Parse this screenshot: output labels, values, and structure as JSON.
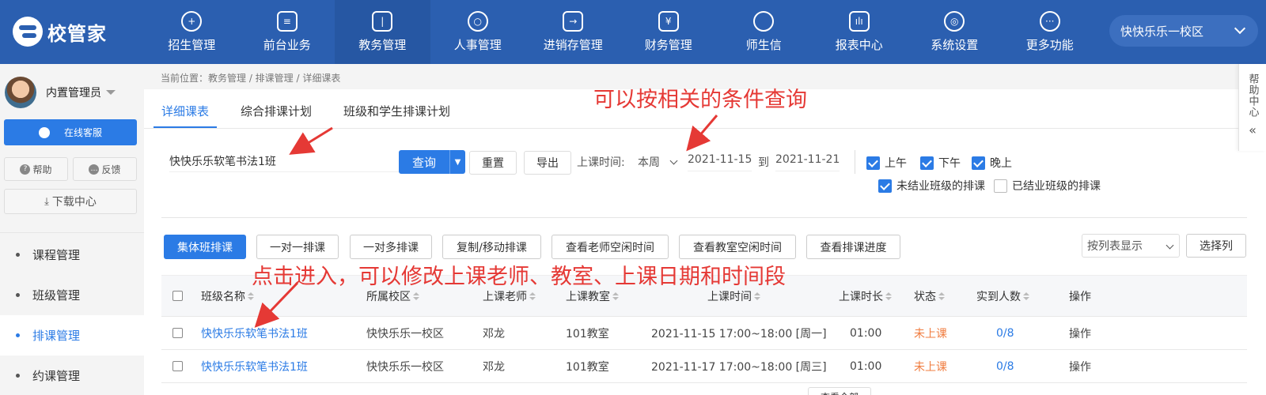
{
  "app": {
    "logo_text": "校管家",
    "campus_selector": "快快乐乐一校区"
  },
  "top_nav": [
    {
      "label": "招生管理",
      "icon": "person-add-icon",
      "active": false
    },
    {
      "label": "前台业务",
      "icon": "monitor-icon",
      "active": false
    },
    {
      "label": "教务管理",
      "icon": "book-icon",
      "active": true
    },
    {
      "label": "人事管理",
      "icon": "person-icon",
      "active": false
    },
    {
      "label": "进销存管理",
      "icon": "inventory-icon",
      "active": false
    },
    {
      "label": "财务管理",
      "icon": "yuan-icon",
      "active": false
    },
    {
      "label": "师生信",
      "icon": "chat-icon",
      "active": false
    },
    {
      "label": "报表中心",
      "icon": "report-icon",
      "active": false
    },
    {
      "label": "系统设置",
      "icon": "settings-icon",
      "active": false
    },
    {
      "label": "更多功能",
      "icon": "more-icon",
      "active": false
    }
  ],
  "sidebar": {
    "user_name": "内置管理员",
    "online_service": "在线客服",
    "help": "帮助",
    "feedback": "反馈",
    "download_center": "下载中心",
    "menu": [
      {
        "label": "课程管理",
        "active": false
      },
      {
        "label": "班级管理",
        "active": false
      },
      {
        "label": "排课管理",
        "active": true
      },
      {
        "label": "约课管理",
        "active": false
      }
    ]
  },
  "breadcrumb": "当前位置：教务管理 / 排课管理 / 详细课表",
  "tabs": [
    {
      "label": "详细课表",
      "active": true
    },
    {
      "label": "综合排课计划",
      "active": false
    },
    {
      "label": "班级和学生排课计划",
      "active": false
    }
  ],
  "filters": {
    "search_value": "快快乐乐软笔书法1班",
    "query_label": "查询",
    "reset_label": "重置",
    "export_label": "导出",
    "time_label": "上课时间:",
    "week_value": "本周",
    "date_from": "2021-11-15",
    "to_label": "到",
    "date_to": "2021-11-21",
    "morning": "上午",
    "afternoon": "下午",
    "evening": "晚上",
    "unfinished_class": "未结业班级的排课",
    "finished_class": "已结业班级的排课"
  },
  "actions": {
    "group_schedule": "集体班排课",
    "one_to_one": "一对一排课",
    "one_to_many": "一对多排课",
    "copy_move": "复制/移动排课",
    "teacher_free": "查看老师空闲时间",
    "room_free": "查看教室空闲时间",
    "progress": "查看排课进度",
    "view_mode": "按列表显示",
    "choose_columns": "选择列"
  },
  "table": {
    "headers": [
      "班级名称",
      "所属校区",
      "上课老师",
      "上课教室",
      "上课时间",
      "上课时长",
      "状态",
      "实到人数",
      "操作"
    ],
    "rows": [
      {
        "class_name": "快快乐乐软笔书法1班",
        "campus": "快快乐乐一校区",
        "teacher": "邓龙",
        "room": "101教室",
        "time": "2021-11-15 17:00~18:00 [周一]",
        "duration": "01:00",
        "status": "未上课",
        "attendance": "0/8",
        "op": "操作"
      },
      {
        "class_name": "快快乐乐软笔书法1班",
        "campus": "快快乐乐一校区",
        "teacher": "邓龙",
        "room": "101教室",
        "time": "2021-11-17 17:00~18:00 [周三]",
        "duration": "01:00",
        "status": "未上课",
        "attendance": "0/8",
        "op": "操作"
      }
    ],
    "partial_button": "查看全部"
  },
  "help_panel": {
    "label": "帮助中心"
  },
  "annotations": {
    "query_note": "可以按相关的条件查询",
    "edit_note": "点击进入，可以修改上课老师、教室、上课日期和时间段"
  },
  "colors": {
    "nav_bg": "#2b5fb0",
    "primary": "#2b7be5",
    "status_not_started": "#f07c3f",
    "annotation": "#e53935"
  }
}
